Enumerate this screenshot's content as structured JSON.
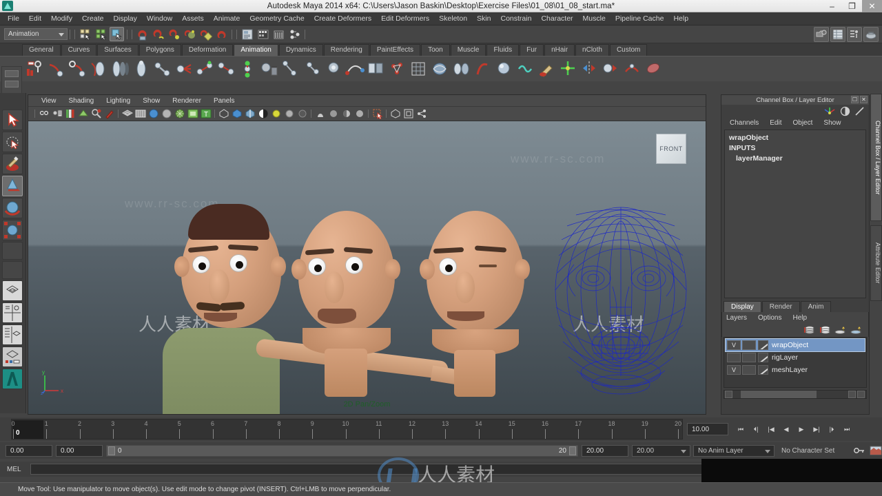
{
  "window": {
    "title": "Autodesk Maya 2014 x64: C:\\Users\\Jason Baskin\\Desktop\\Exercise Files\\01_08\\01_08_start.ma*",
    "minimize": "–",
    "maximize": "❐",
    "close": "✕"
  },
  "menubar": {
    "items": [
      "File",
      "Edit",
      "Modify",
      "Create",
      "Display",
      "Window",
      "Assets",
      "Animate",
      "Geometry Cache",
      "Create Deformers",
      "Edit Deformers",
      "Skeleton",
      "Skin",
      "Constrain",
      "Character",
      "Muscle",
      "Pipeline Cache",
      "Help"
    ]
  },
  "statusline": {
    "menuset": "Animation"
  },
  "shelf": {
    "tabs": [
      "General",
      "Curves",
      "Surfaces",
      "Polygons",
      "Deformation",
      "Animation",
      "Dynamics",
      "Rendering",
      "PaintEffects",
      "Toon",
      "Muscle",
      "Fluids",
      "Fur",
      "nHair",
      "nCloth",
      "Custom"
    ],
    "active": "Animation"
  },
  "viewport": {
    "menus": [
      "View",
      "Shading",
      "Lighting",
      "Show",
      "Renderer",
      "Panels"
    ],
    "viewcube": "FRONT",
    "pan_zoom": "2D Pan/Zoom",
    "axis_x": "x",
    "axis_y": "y",
    "axis_z": "z",
    "watermark": "www.rr-sc.com"
  },
  "channelbox": {
    "title": "Channel Box / Layer Editor",
    "menus": [
      "Channels",
      "Edit",
      "Object",
      "Show"
    ],
    "object": "wrapObject",
    "inputs_label": "INPUTS",
    "inputs": [
      "layerManager"
    ]
  },
  "layereditor": {
    "tabs": [
      "Display",
      "Render",
      "Anim"
    ],
    "active_tab": "Display",
    "menus": [
      "Layers",
      "Options",
      "Help"
    ],
    "layers": [
      {
        "visible": "V",
        "name": "wrapObject",
        "selected": true
      },
      {
        "visible": "",
        "name": "rigLayer",
        "selected": false
      },
      {
        "visible": "V",
        "name": "meshLayer",
        "selected": false
      }
    ]
  },
  "vertical_tabs": [
    "Channel Box / Layer Editor",
    "Attribute Editor"
  ],
  "timeline": {
    "current_frame": "0",
    "ticks": [
      "0",
      "1",
      "2",
      "3",
      "4",
      "5",
      "6",
      "7",
      "8",
      "9",
      "10",
      "11",
      "12",
      "13",
      "14",
      "15",
      "16",
      "17",
      "18",
      "19",
      "20"
    ],
    "playback_speed": "10.00",
    "buttons": [
      "⏮",
      "⏴|",
      "|◀",
      "◀",
      "▶",
      "▶|",
      "|⏵",
      "⏭"
    ]
  },
  "rangeslider": {
    "start": "0.00",
    "end": "0.00",
    "range_start_label": "0",
    "range_end_label": "20",
    "anim_start": "20.00",
    "anim_end": "20.00",
    "anim_layer": "No Anim Layer",
    "character_set": "No Character Set"
  },
  "commandline": {
    "label": "MEL",
    "value": ""
  },
  "statusbar": {
    "help": "Move Tool: Use manipulator to move object(s).  Use edit mode to change pivot (INSERT).   Ctrl+LMB to move perpendicular."
  },
  "colors": {
    "accent_selected": "#7396c4",
    "wireframe": "#1b26c8",
    "shirt": "#8d9b6e",
    "skin": "#d49f7c",
    "hair": "#4a2b22"
  }
}
